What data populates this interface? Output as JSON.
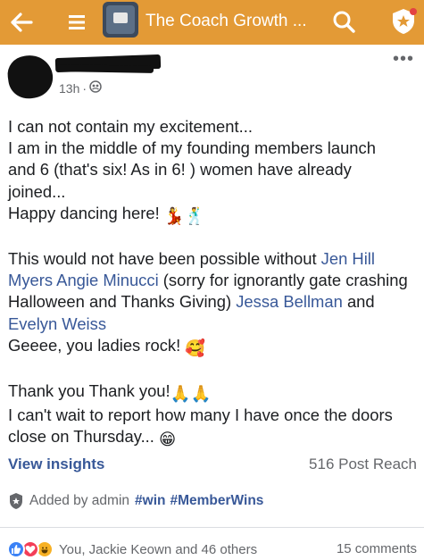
{
  "header": {
    "title": "The Coach Growth ...",
    "back_icon": "arrow-left-icon",
    "menu_icon": "hamburger-icon",
    "search_icon": "search-icon",
    "badge_icon": "admin-shield-icon",
    "bar_color": "#e39a36"
  },
  "post": {
    "time": "13h",
    "separator": "·",
    "privacy_icon": "group-members-icon",
    "more_label": "•••",
    "body": {
      "p1_l1": "I can not contain my excitement...",
      "p1_l2": "I am in the middle of my founding members launch",
      "p1_l3": "and 6 (that's six! As in 6! ) women have already",
      "p1_l4": "joined...",
      "p1_l5": "Happy dancing here!",
      "p2_a": "This would not have been possible without ",
      "mention1": "Jen Hill Myers",
      "p2_b": " ",
      "mention2": "Angie Minucci",
      "p2_c": " (sorry for ignorantly gate crashing Halloween and Thanks Giving) ",
      "mention3": "Jessa Bellman",
      "p2_d": " and ",
      "mention4": "Evelyn Weiss",
      "p2_e": "Geeee, you ladies rock!",
      "p3_l1": "Thank you Thank you!",
      "p3_l2": "I can't wait to report how many I have once the doors close on Thursday..."
    },
    "emojis": {
      "dancer": "💃",
      "man_dancing": "🕺",
      "smiling_hearts": "🥰",
      "pray": "🙏",
      "grin": "😁"
    },
    "insights_label": "View insights",
    "reach": "516 Post Reach",
    "added_by": "Added by admin",
    "tags": [
      "#win",
      "#MemberWins"
    ],
    "reactions_text": "You, Jackie Keown and 46 others",
    "comments": "15 comments",
    "accent_color": "#385898"
  }
}
